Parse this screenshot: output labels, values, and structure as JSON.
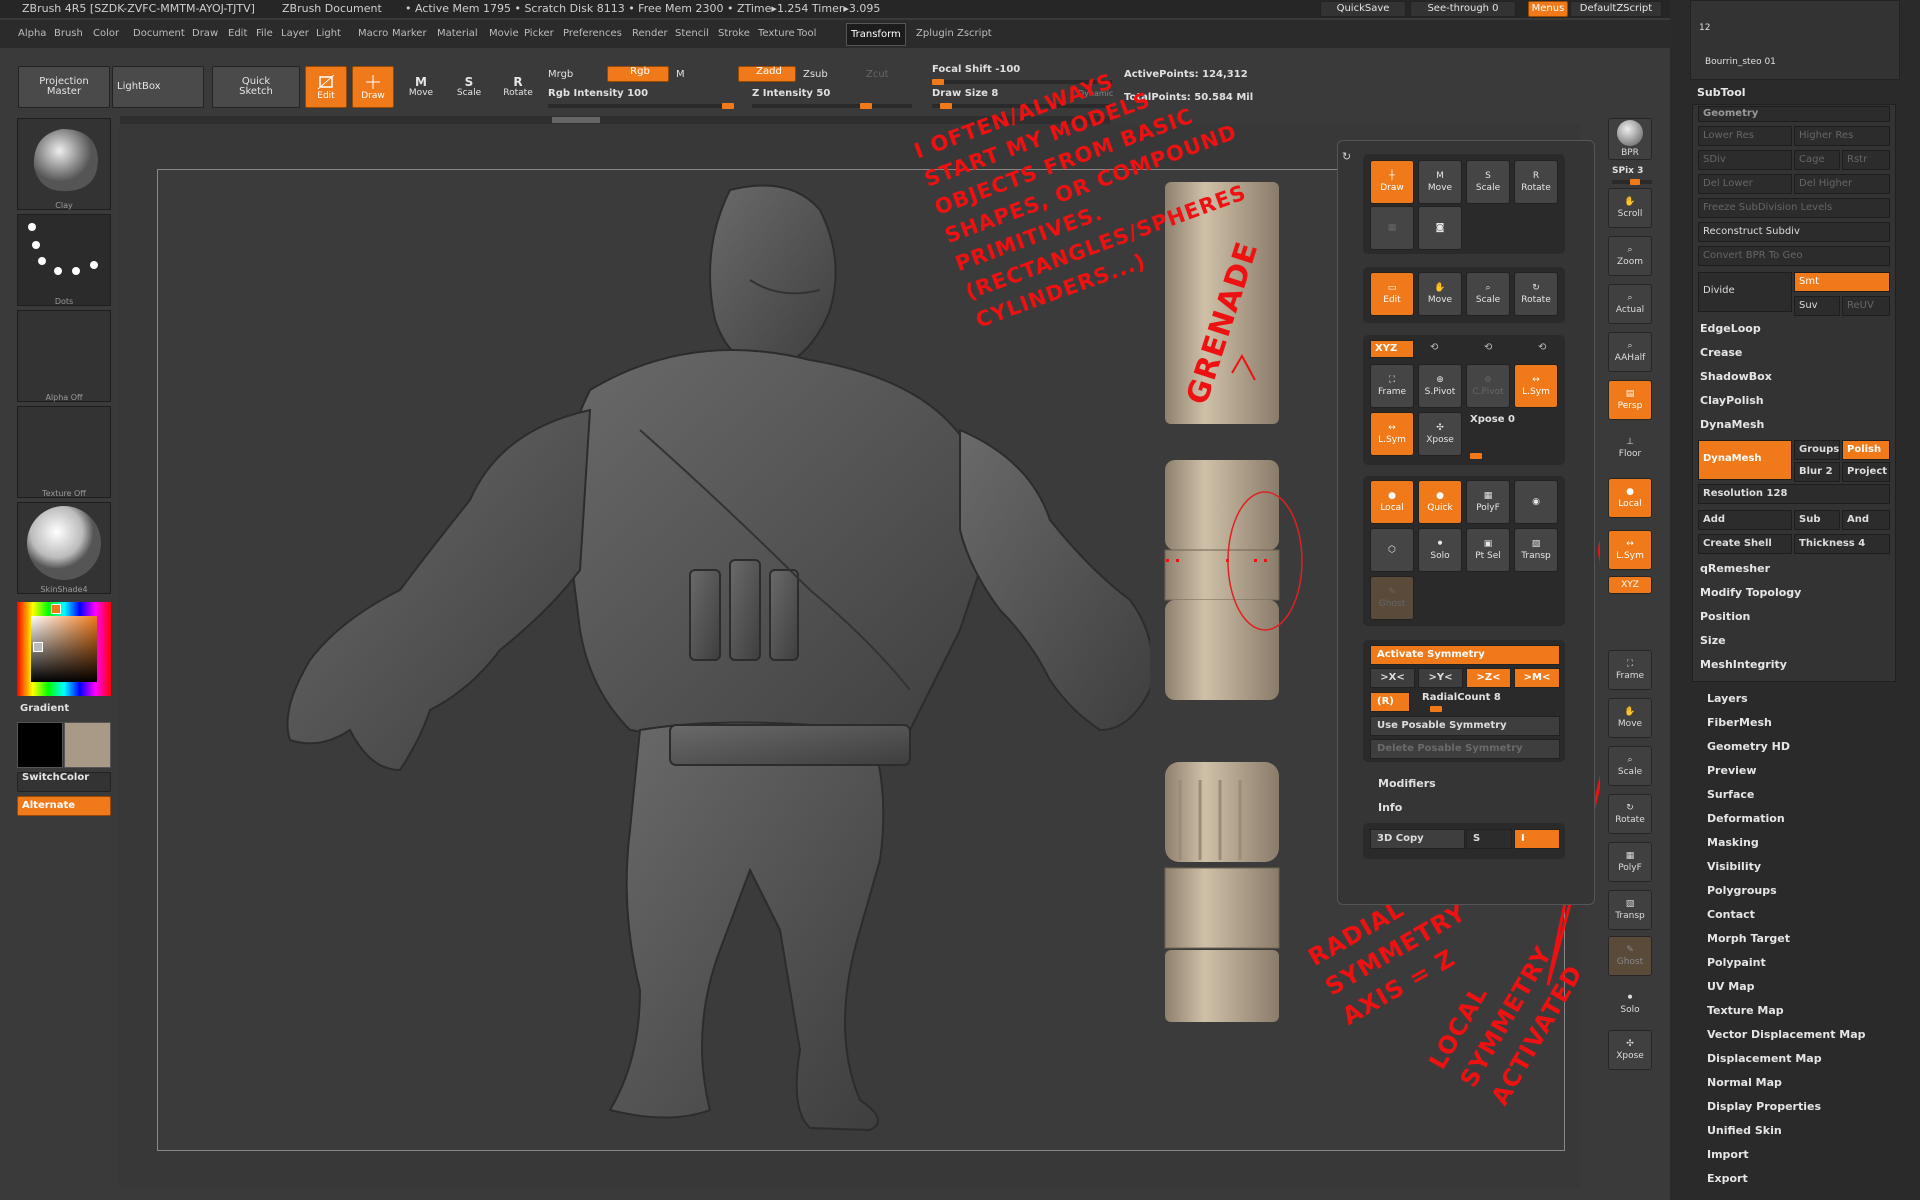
{
  "titlebar": {
    "app": "ZBrush 4R5 [SZDK-ZVFC-MMTM-AYOJ-TJTV]",
    "doc": "ZBrush Document",
    "stats": "• Active Mem 1795 • Scratch Disk 8113 • Free Mem 2300 • ZTime▸1.254 Timer▸3.095",
    "quicksave": "QuickSave",
    "seethrough": "See-through 0",
    "menus": "Menus",
    "script": "DefaultZScript"
  },
  "menu": [
    "Alpha",
    "Brush",
    "Color",
    "Document",
    "Draw",
    "Edit",
    "File",
    "Layer",
    "Light",
    "Macro",
    "Marker",
    "Material",
    "Movie",
    "Picker",
    "Preferences",
    "Render",
    "Stencil",
    "Stroke",
    "Texture",
    "Tool",
    "Transform",
    "Zplugin",
    "Zscript"
  ],
  "menu_active": "Transform",
  "shelf": {
    "projection_master": "Projection Master",
    "lightbox": "LightBox",
    "quick_sketch": "Quick Sketch",
    "edit": "Edit",
    "draw": "Draw",
    "move": "Move",
    "scale": "Scale",
    "rotate": "Rotate",
    "mrgb": "Mrgb",
    "rgb": "Rgb",
    "m": "M",
    "zadd": "Zadd",
    "zsub": "Zsub",
    "zcut": "Zcut",
    "rgb_intensity": "Rgb Intensity 100",
    "z_intensity": "Z Intensity 50",
    "focal_shift": "Focal Shift -100",
    "draw_size": "Draw Size 8",
    "dynamic": "Dynamic",
    "active_points": "ActivePoints: 124,312",
    "total_points": "TotalPoints: 50.584 Mil"
  },
  "left": {
    "material": "Clay",
    "stroke": "Dots",
    "alpha": "Alpha Off",
    "texture": "Texture Off",
    "material2": "SkinShade4",
    "gradient": "Gradient",
    "switchcolor": "SwitchColor",
    "alternate": "Alternate"
  },
  "right_shelf": [
    "BPR",
    "SPix 3",
    "Scroll",
    "Zoom",
    "Actual",
    "AAHalf",
    "Persp",
    "Floor",
    "Local",
    "L.Sym",
    "XYZ",
    "Frame",
    "Move",
    "Scale",
    "Rotate",
    "PolyF",
    "Transp",
    "Ghost",
    "Solo",
    "Xpose"
  ],
  "popup": {
    "row1": [
      "Draw",
      "Move",
      "Scale",
      "Rotate"
    ],
    "row2": [
      "Edit",
      "Move",
      "Scale",
      "Rotate"
    ],
    "xyz": "XYZ",
    "frame": "Frame",
    "spivot": "S.Pivot",
    "cpivot": "C.Pivot",
    "lsym": "L.Sym",
    "lsym2": "L.Sym",
    "xpose": "Xpose",
    "xpose_val": "Xpose 0",
    "local": "Local",
    "quick": "Quick",
    "polyf": "PolyF",
    "solo": "Solo",
    "ptsel": "Pt Sel",
    "transp": "Transp",
    "ghost": "Ghost",
    "activate_symmetry": "Activate Symmetry",
    "axes": [
      ">X<",
      ">Y<",
      ">Z<",
      ">M<"
    ],
    "r": "(R)",
    "radial_count": "RadialCount 8",
    "use_posable": "Use Posable Symmetry",
    "delete_posable": "Delete Posable Symmetry",
    "modifiers": "Modifiers",
    "info": "Info",
    "copy3d": "3D Copy",
    "s": "S",
    "i": "I"
  },
  "tray": {
    "counter": "12",
    "thumb_label": "Bourrin_steo 01",
    "subtool": "SubTool",
    "geometry": "Geometry",
    "lower_res": "Lower Res",
    "higher_res": "Higher Res",
    "sdiv": "SDiv",
    "cage": "Cage",
    "rstr": "Rstr",
    "del_lower": "Del Lower",
    "del_higher": "Del Higher",
    "freeze": "Freeze SubDivision Levels",
    "reconstruct": "Reconstruct Subdiv",
    "convert_bpr": "Convert BPR To Geo",
    "divide": "Divide",
    "smt": "Smt",
    "suv": "Suv",
    "reuv": "ReUV",
    "edgeloop": "EdgeLoop",
    "crease": "Crease",
    "shadowbox": "ShadowBox",
    "claypolish": "ClayPolish",
    "dynamesh_hdr": "DynaMesh",
    "dynamesh_btn": "DynaMesh",
    "groups": "Groups",
    "polish": "Polish",
    "blur": "Blur 2",
    "project": "Project",
    "resolution": "Resolution 128",
    "add": "Add",
    "sub": "Sub",
    "and": "And",
    "create_shell": "Create Shell",
    "thickness": "Thickness 4",
    "qremesher": "qRemesher",
    "modify_topology": "Modify Topology",
    "position": "Position",
    "size": "Size",
    "meshintegrity": "MeshIntegrity",
    "sections": [
      "Layers",
      "FiberMesh",
      "Geometry HD",
      "Preview",
      "Surface",
      "Deformation",
      "Masking",
      "Visibility",
      "Polygroups",
      "Contact",
      "Morph Target",
      "Polypaint",
      "UV Map",
      "Texture Map",
      "Vector Displacement Map",
      "Displacement Map",
      "Normal Map",
      "Display Properties",
      "Unified Skin",
      "Import",
      "Export"
    ]
  },
  "annotations": {
    "note1": [
      "I OFTEN/ALWAYS",
      "START MY MODELS",
      "OBJECTS FROM BASIC",
      "SHAPES, OR COMPOUND",
      "PRIMITIVES.",
      "(RECTANGLES/SPHERES",
      "CYLINDERS...)"
    ],
    "grenade": "GRENADE",
    "radial": [
      "RADIAL",
      "SYMMETRY",
      "AXIS = Z"
    ],
    "local": [
      "LOCAL",
      "SYMMETRY",
      "ACTIVATED"
    ]
  },
  "colors": {
    "accent": "#f07a1a",
    "annotation": "#e01010",
    "panel": "#3a3a3a",
    "tray": "#2a2a2a"
  }
}
